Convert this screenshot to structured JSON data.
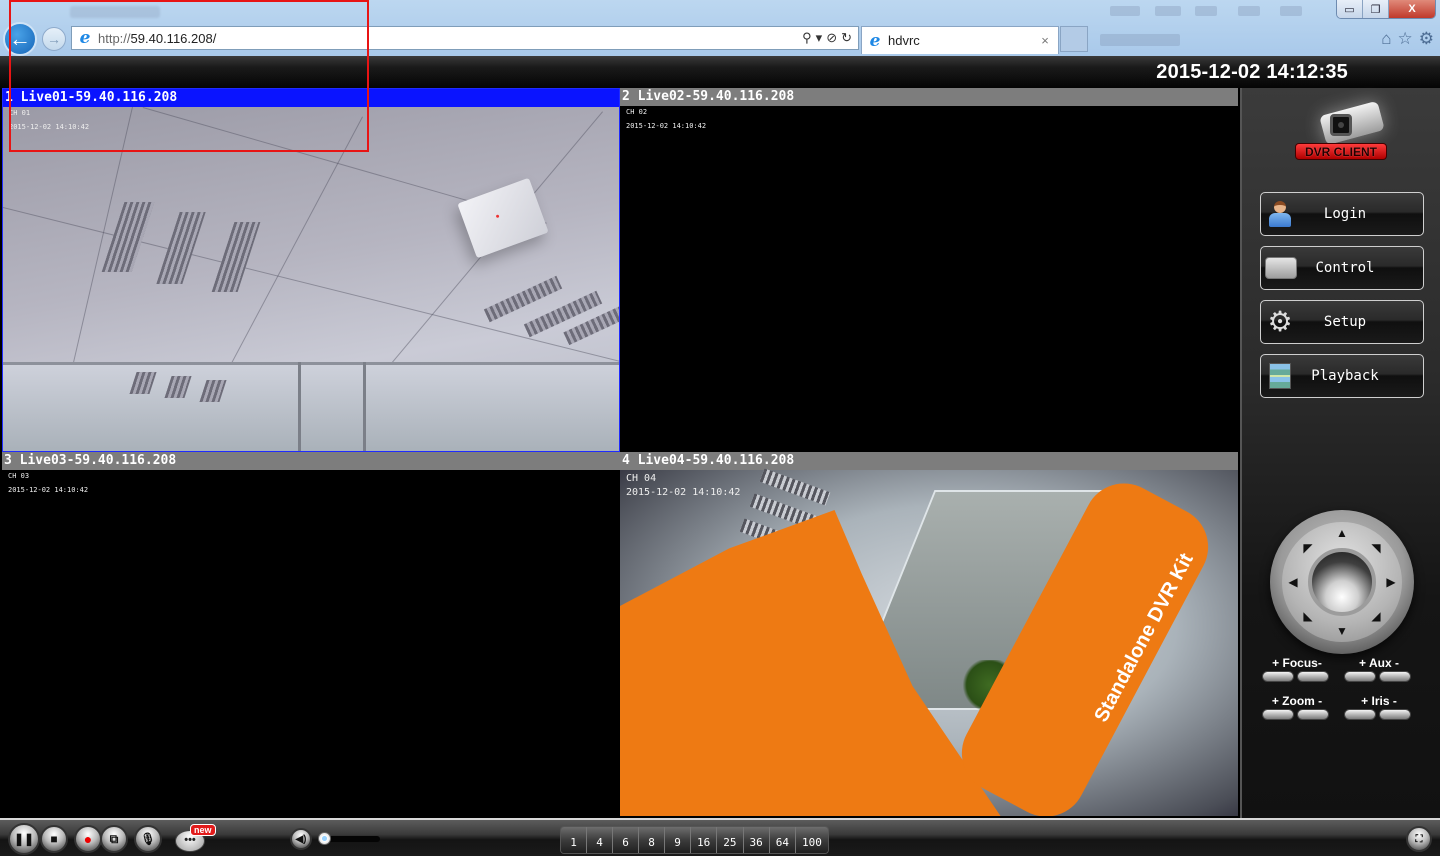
{
  "browser": {
    "url_protocol": "http://",
    "url_host": "59.40.116.208/",
    "tab_title": "hdvrc",
    "window_buttons": {
      "minimize": "▭",
      "restore": "❐",
      "close": "X"
    },
    "address_tools": {
      "search": "⚲",
      "dropdown": "▾",
      "stop": "⊘",
      "refresh": "↻"
    },
    "right_tools": {
      "home": "⌂",
      "favorites": "☆",
      "settings": "⚙"
    },
    "tab_close": "×",
    "back": "←",
    "forward": "→",
    "ie_glyph": "e"
  },
  "app": {
    "datetime": "2015-12-02 14:12:35",
    "channels": [
      {
        "index": "1",
        "title": "1 Live01-59.40.116.208",
        "osd_ch": "CH 01",
        "osd_time": "2015-12-02 14:10:42",
        "selected": true,
        "has_video": true
      },
      {
        "index": "2",
        "title": "2 Live02-59.40.116.208",
        "osd_ch": "CH 02",
        "osd_time": "2015-12-02 14:10:42",
        "selected": false,
        "has_video": false
      },
      {
        "index": "3",
        "title": "3 Live03-59.40.116.208",
        "osd_ch": "CH 03",
        "osd_time": "2015-12-02 14:10:42",
        "selected": false,
        "has_video": false
      },
      {
        "index": "4",
        "title": "4 Live04-59.40.116.208",
        "osd_ch": "CH 04",
        "osd_time": "2015-12-02 14:10:42",
        "selected": false,
        "has_video": true
      }
    ],
    "feed4_banner_text": "Standalone DVR Kit"
  },
  "sidebar": {
    "logo_text": "DVR CLIENT",
    "buttons": [
      {
        "label": "Login",
        "icon": "user-icon"
      },
      {
        "label": "Control",
        "icon": "hard-drive-icon"
      },
      {
        "label": "Setup",
        "icon": "gear-icon"
      },
      {
        "label": "Playback",
        "icon": "film-icon"
      }
    ],
    "ptz": {
      "arrows": {
        "up": "▲",
        "down": "▼",
        "left": "◀",
        "right": "▶",
        "up_left": "◤",
        "up_right": "◥",
        "down_left": "◣",
        "down_right": "◢"
      },
      "controls": [
        {
          "label": "+ Focus-"
        },
        {
          "label": "+ Aux  -"
        },
        {
          "label": "+ Zoom -"
        },
        {
          "label": "+ Iris -"
        }
      ]
    }
  },
  "toolbar": {
    "pause_glyph": "❚❚",
    "stop_glyph": "■",
    "record_glyph": "●",
    "snapshot_glyph": "⧉",
    "mic_glyph": "🎙",
    "chat_glyph": "•••",
    "new_badge": "new",
    "volume_glyph": "◀)",
    "volume_level": 0,
    "layouts": [
      "1",
      "4",
      "6",
      "8",
      "9",
      "16",
      "25",
      "36",
      "64",
      "100"
    ],
    "fullscreen_glyph": "⛶"
  }
}
